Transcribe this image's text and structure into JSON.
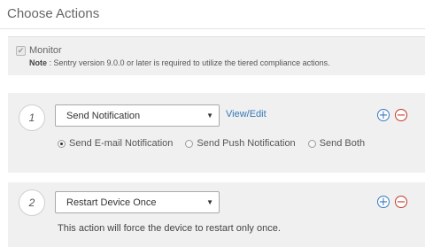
{
  "header": {
    "title": "Choose Actions"
  },
  "monitor": {
    "checked": true,
    "label": "Monitor",
    "note_label": "Note",
    "note_text": ": Sentry version 9.0.0 or later is required to utilize the tiered compliance actions."
  },
  "actions": [
    {
      "step": "1",
      "selected": "Send Notification",
      "link": "View/Edit",
      "options": [
        {
          "label": "Send E-mail Notification",
          "checked": true
        },
        {
          "label": "Send Push Notification",
          "checked": false
        },
        {
          "label": "Send Both",
          "checked": false
        }
      ]
    },
    {
      "step": "2",
      "selected": "Restart Device Once",
      "description": "This action will force the device to restart only once."
    }
  ],
  "icons": {
    "add": "plus-circle-icon",
    "remove": "minus-circle-icon",
    "check": "check-icon",
    "caret": "caret-down-icon"
  },
  "colors": {
    "link": "#337ab7",
    "add": "#3c78c3",
    "remove": "#c0392b",
    "panel": "#f0f0f0"
  }
}
